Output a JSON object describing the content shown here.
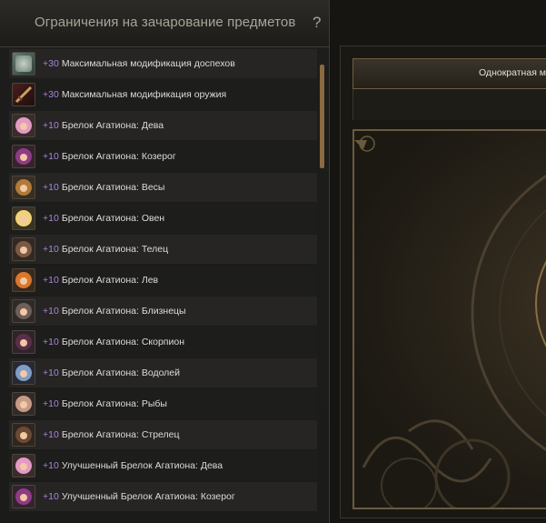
{
  "panel": {
    "title": "Ограничения на зачарование предметов",
    "help": "?"
  },
  "items": [
    {
      "level": "+30",
      "name": "Максимальная модификация доспехов",
      "icon": "armor-icon"
    },
    {
      "level": "+30",
      "name": "Максимальная модификация оружия",
      "icon": "weapon-icon"
    },
    {
      "level": "+10",
      "name": "Брелок Агатиона: Дева",
      "icon": "agathion-virgo-icon"
    },
    {
      "level": "+10",
      "name": "Брелок Агатиона: Козерог",
      "icon": "agathion-capricorn-icon"
    },
    {
      "level": "+10",
      "name": "Брелок Агатиона: Весы",
      "icon": "agathion-libra-icon"
    },
    {
      "level": "+10",
      "name": "Брелок Агатиона: Овен",
      "icon": "agathion-aries-icon"
    },
    {
      "level": "+10",
      "name": "Брелок Агатиона: Телец",
      "icon": "agathion-taurus-icon"
    },
    {
      "level": "+10",
      "name": "Брелок Агатиона: Лев",
      "icon": "agathion-leo-icon"
    },
    {
      "level": "+10",
      "name": "Брелок Агатиона: Близнецы",
      "icon": "agathion-gemini-icon"
    },
    {
      "level": "+10",
      "name": "Брелок Агатиона: Скорпион",
      "icon": "agathion-scorpio-icon"
    },
    {
      "level": "+10",
      "name": "Брелок Агатиона: Водолей",
      "icon": "agathion-aquarius-icon"
    },
    {
      "level": "+10",
      "name": "Брелок Агатиона: Рыбы",
      "icon": "agathion-pisces-icon"
    },
    {
      "level": "+10",
      "name": "Брелок Агатиона: Стрелец",
      "icon": "agathion-sagittarius-icon"
    },
    {
      "level": "+10",
      "name": "Улучшенный Брелок Агатиона: Дева",
      "icon": "improved-agathion-virgo-icon"
    },
    {
      "level": "+10",
      "name": "Улучшенный Брелок Агатиона: Козерог",
      "icon": "improved-agathion-capricorn-icon"
    }
  ],
  "tab": {
    "label": "Однократная м"
  },
  "colors": {
    "level": "#a983de",
    "text": "#dedbd4",
    "title": "#a9a49a",
    "scrollbar": "#8a6a3f"
  }
}
